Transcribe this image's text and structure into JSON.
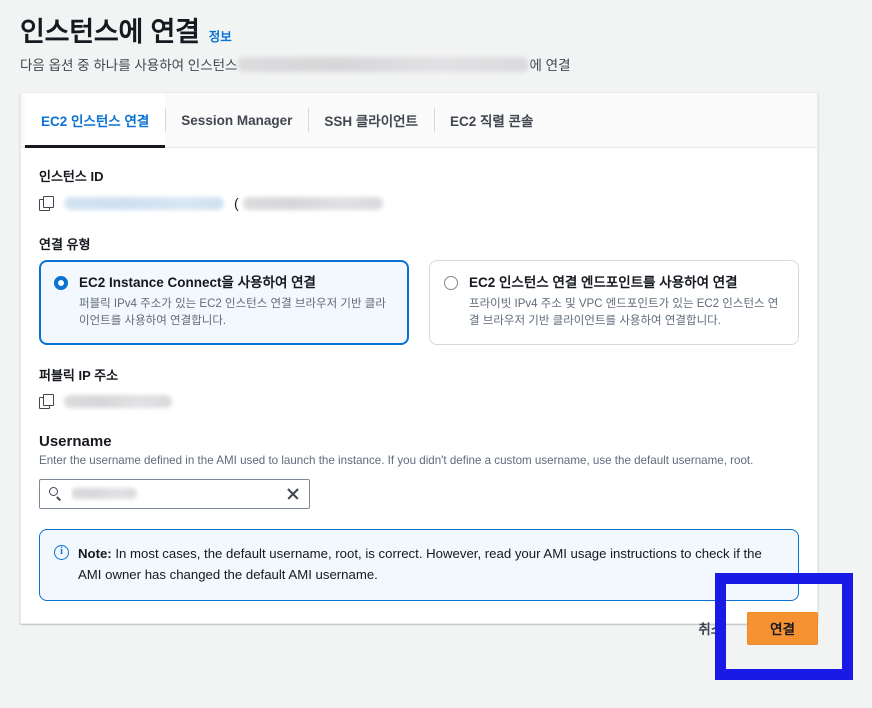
{
  "header": {
    "title": "인스턴스에 연결",
    "info_link": "정보",
    "subtitle_prefix": "다음 옵션 중 하나를 사용하여 인스턴스 ",
    "subtitle_suffix": "에 연결",
    "subtitle_redacted": true
  },
  "tabs": [
    {
      "label": "EC2 인스턴스 연결",
      "active": true
    },
    {
      "label": "Session Manager",
      "active": false
    },
    {
      "label": "SSH 클라이언트",
      "active": false
    },
    {
      "label": "EC2 직렬 콘솔",
      "active": false
    }
  ],
  "instance_id": {
    "label": "인스턴스 ID",
    "copy_icon": "copy-icon",
    "value_redacted": true,
    "paren_open": "("
  },
  "connection_type": {
    "label": "연결 유형",
    "options": [
      {
        "title": "EC2 Instance Connect을 사용하여 연결",
        "description": "퍼블릭 IPv4 주소가 있는 EC2 인스턴스 연결 브라우저 기반 클라이언트를 사용하여 연결합니다.",
        "selected": true
      },
      {
        "title": "EC2 인스턴스 연결 엔드포인트를 사용하여 연결",
        "description": "프라이빗 IPv4 주소 및 VPC 엔드포인트가 있는 EC2 인스턴스 연결 브라우저 기반 클라이언트를 사용하여 연결합니다.",
        "selected": false
      }
    ]
  },
  "public_ip": {
    "label": "퍼블릭 IP 주소",
    "copy_icon": "copy-icon",
    "value_redacted": true
  },
  "username": {
    "label": "Username",
    "description": "Enter the username defined in the AMI used to launch the instance. If you didn't define a custom username, use the default username, root.",
    "search_icon": "search-icon",
    "clear_icon": "close-icon",
    "value_redacted": true
  },
  "note": {
    "icon": "info-circle-icon",
    "bold_label": "Note:",
    "text": " In most cases, the default username, root, is correct. However, read your AMI usage instructions to check if the AMI owner has changed the default AMI username."
  },
  "footer": {
    "cancel_label": "취소",
    "connect_label": "연결"
  },
  "annotation": {
    "shape": "rectangle-highlight",
    "color": "#1a1ae6",
    "target": "연결"
  },
  "colors": {
    "accent_blue": "#0972d3",
    "primary_button": "#f79232",
    "page_background": "#f2f3f3",
    "annotation": "#1a1ae6"
  }
}
